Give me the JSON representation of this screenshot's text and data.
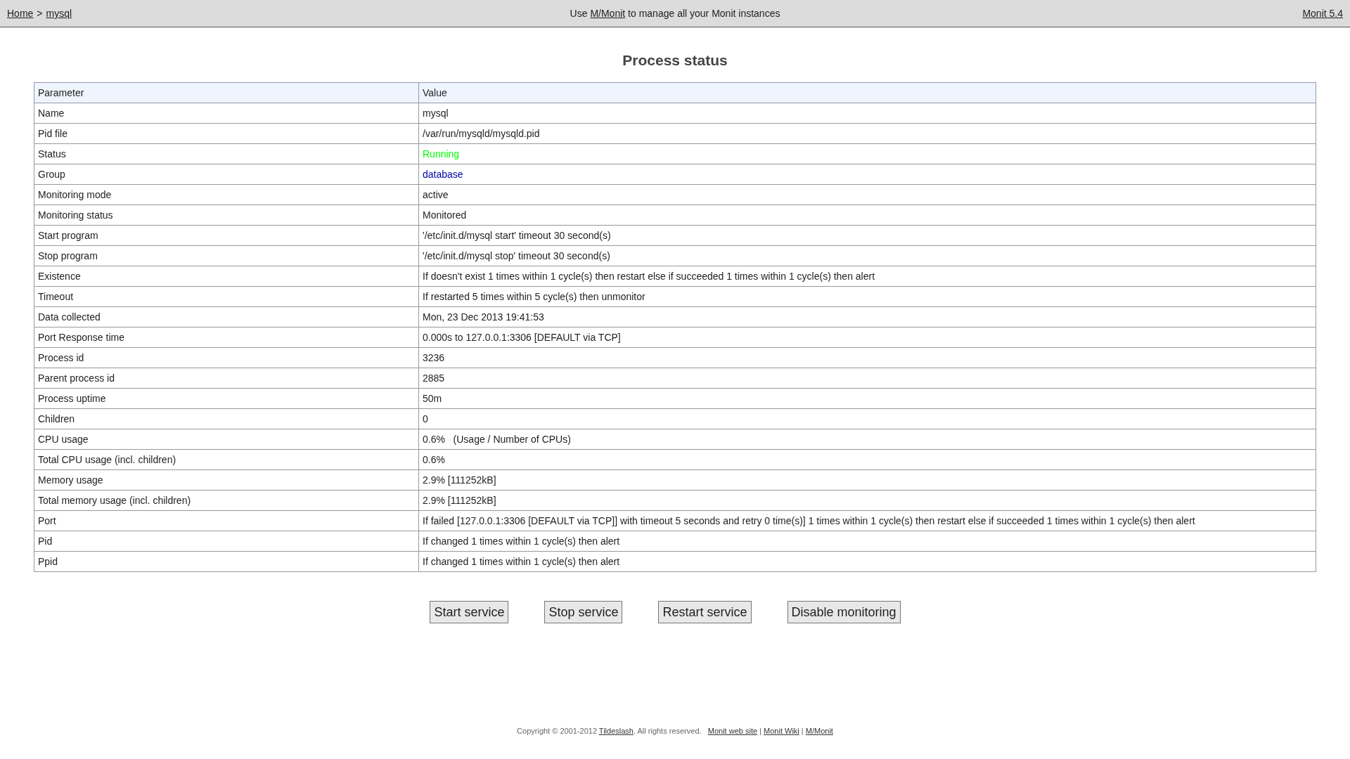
{
  "header": {
    "breadcrumb": [
      {
        "label": "Home"
      },
      {
        "label": "mysql"
      }
    ],
    "breadcrumb_separator": ">",
    "notice": {
      "before": "Use ",
      "link": "M/Monit",
      "after": " to manage all your Monit instances"
    },
    "version_link": "Monit 5.4"
  },
  "title": "Process status",
  "table": {
    "columns": [
      "Parameter",
      "Value"
    ],
    "rows": [
      {
        "parameter": "Name",
        "value": "mysql"
      },
      {
        "parameter": "Pid file",
        "value": "/var/run/mysqld/mysqld.pid"
      },
      {
        "parameter": "Status",
        "value": "Running",
        "color": "#00ff00"
      },
      {
        "parameter": "Group",
        "value": "database",
        "color": "#0000aa"
      },
      {
        "parameter": "Monitoring mode",
        "value": "active"
      },
      {
        "parameter": "Monitoring status",
        "value": "Monitored"
      },
      {
        "parameter": "Start program",
        "value": "'/etc/init.d/mysql start' timeout 30 second(s)"
      },
      {
        "parameter": "Stop program",
        "value": "'/etc/init.d/mysql stop' timeout 30 second(s)"
      },
      {
        "parameter": "Existence",
        "value": "If doesn't exist 1 times within 1 cycle(s) then restart else if succeeded 1 times within 1 cycle(s) then alert"
      },
      {
        "parameter": "Timeout",
        "value": "If restarted 5 times within 5 cycle(s) then unmonitor"
      },
      {
        "parameter": "Data collected",
        "value": "Mon, 23 Dec 2013 19:41:53"
      },
      {
        "parameter": "Port Response time",
        "value": "0.000s to 127.0.0.1:3306 [DEFAULT via TCP]"
      },
      {
        "parameter": "Process id",
        "value": "3236"
      },
      {
        "parameter": "Parent process id",
        "value": "2885"
      },
      {
        "parameter": "Process uptime",
        "value": "50m"
      },
      {
        "parameter": "Children",
        "value": "0"
      },
      {
        "parameter": "CPU usage",
        "value": "0.6%   (Usage / Number of CPUs)"
      },
      {
        "parameter": "Total CPU usage (incl. children)",
        "value": "0.6%"
      },
      {
        "parameter": "Memory usage",
        "value": "2.9% [111252kB]"
      },
      {
        "parameter": "Total memory usage (incl. children)",
        "value": "2.9% [111252kB]"
      },
      {
        "parameter": "Port",
        "value": "If failed [127.0.0.1:3306 [DEFAULT via TCP]] with timeout 5 seconds and retry 0 time(s)] 1 times within 1 cycle(s) then restart else if succeeded 1 times within 1 cycle(s) then alert"
      },
      {
        "parameter": "Pid",
        "value": "If changed 1 times within 1 cycle(s) then alert"
      },
      {
        "parameter": "Ppid",
        "value": "If changed 1 times within 1 cycle(s) then alert"
      }
    ]
  },
  "buttons": [
    "Start service",
    "Stop service",
    "Restart service",
    "Disable monitoring"
  ],
  "footer": {
    "copyright": "Copyright © 2001-2012 ",
    "company_link": "Tildeslash",
    "rights": ". All rights reserved.",
    "links": [
      "Monit web site",
      "Monit Wiki",
      "M/Monit"
    ],
    "link_separator": "|"
  }
}
